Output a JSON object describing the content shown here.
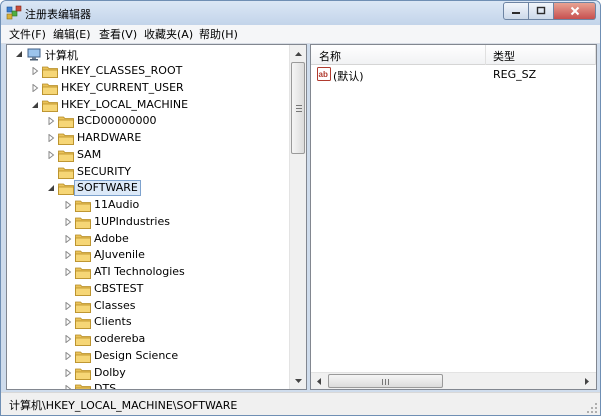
{
  "window": {
    "title": "注册表编辑器"
  },
  "menu": [
    {
      "label": "文件(F)"
    },
    {
      "label": "编辑(E)"
    },
    {
      "label": "查看(V)"
    },
    {
      "label": "收藏夹(A)"
    },
    {
      "label": "帮助(H)"
    }
  ],
  "tree": {
    "root": "计算机",
    "items": [
      {
        "label": "HKEY_CLASSES_ROOT",
        "depth": 1,
        "state": "collapsed"
      },
      {
        "label": "HKEY_CURRENT_USER",
        "depth": 1,
        "state": "collapsed"
      },
      {
        "label": "HKEY_LOCAL_MACHINE",
        "depth": 1,
        "state": "expanded"
      },
      {
        "label": "BCD00000000",
        "depth": 2,
        "state": "collapsed"
      },
      {
        "label": "HARDWARE",
        "depth": 2,
        "state": "collapsed"
      },
      {
        "label": "SAM",
        "depth": 2,
        "state": "collapsed"
      },
      {
        "label": "SECURITY",
        "depth": 2,
        "state": "none"
      },
      {
        "label": "SOFTWARE",
        "depth": 2,
        "state": "expanded",
        "selected": true
      },
      {
        "label": "11Audio",
        "depth": 3,
        "state": "collapsed"
      },
      {
        "label": "1UPIndustries",
        "depth": 3,
        "state": "collapsed"
      },
      {
        "label": "Adobe",
        "depth": 3,
        "state": "collapsed"
      },
      {
        "label": "AJuvenile",
        "depth": 3,
        "state": "collapsed"
      },
      {
        "label": "ATI Technologies",
        "depth": 3,
        "state": "collapsed"
      },
      {
        "label": "CBSTEST",
        "depth": 3,
        "state": "none"
      },
      {
        "label": "Classes",
        "depth": 3,
        "state": "collapsed"
      },
      {
        "label": "Clients",
        "depth": 3,
        "state": "collapsed"
      },
      {
        "label": "codereba",
        "depth": 3,
        "state": "collapsed"
      },
      {
        "label": "Design Science",
        "depth": 3,
        "state": "collapsed"
      },
      {
        "label": "Dolby",
        "depth": 3,
        "state": "collapsed"
      },
      {
        "label": "DTS",
        "depth": 3,
        "state": "collapsed"
      }
    ]
  },
  "values_list": {
    "columns": [
      "名称",
      "类型"
    ],
    "rows": [
      {
        "name": "(默认)",
        "type": "REG_SZ",
        "icon": "string-value-icon"
      }
    ]
  },
  "status": {
    "path": "计算机\\HKEY_LOCAL_MACHINE\\SOFTWARE"
  }
}
